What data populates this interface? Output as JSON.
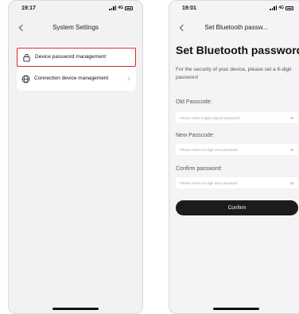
{
  "left_screen": {
    "status": {
      "time": "19:17",
      "network": "4G"
    },
    "nav": {
      "title": "System Settings"
    },
    "menu": [
      {
        "label": "Device password management",
        "icon": "lock-icon",
        "highlighted": true
      },
      {
        "label": "Connection device management",
        "icon": "globe-icon",
        "highlighted": false
      }
    ],
    "highlight_color": "#d8262c"
  },
  "right_screen": {
    "status": {
      "time": "19:01",
      "network": "4G"
    },
    "nav": {
      "title": "Set Bluetooth passw..."
    },
    "title": "Set Bluetooth password",
    "description": "For the security of your device, please set a 6-digit password",
    "fields": [
      {
        "label": "Old Passcode:",
        "placeholder": "Please enter 6-digit original password"
      },
      {
        "label": "New Passcode:",
        "placeholder": "Please enter a 6-digit new password"
      },
      {
        "label": "Confirm password:",
        "placeholder": "Please enter a 6-digit new password"
      }
    ],
    "confirm_label": "Confirm",
    "button_color": "#1c1c1c"
  }
}
